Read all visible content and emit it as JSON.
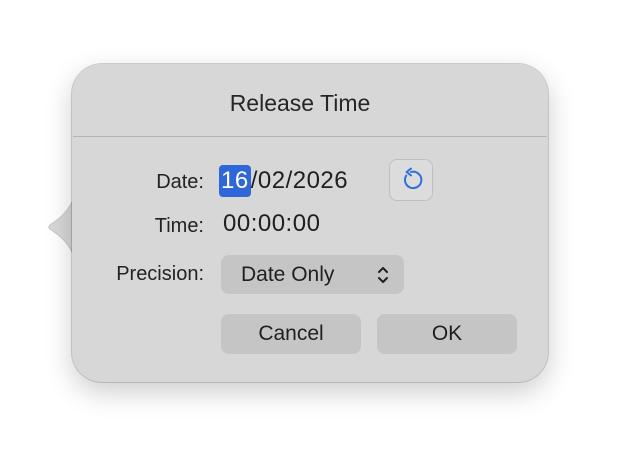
{
  "dialog": {
    "title": "Release Time"
  },
  "fields": {
    "date_label": "Date:",
    "date_day": "16",
    "date_rest": "/02/2026",
    "time_label": "Time:",
    "time_value": "00:00:00",
    "precision_label": "Precision:",
    "precision_value": "Date Only"
  },
  "buttons": {
    "cancel": "Cancel",
    "ok": "OK"
  },
  "icons": {
    "reset": "reset-arrow-icon",
    "chevron": "up-down-chevron-icon"
  },
  "colors": {
    "accent": "#2f67d8",
    "popover_bg": "#d7d7d7",
    "button_bg": "#c5c5c5"
  }
}
